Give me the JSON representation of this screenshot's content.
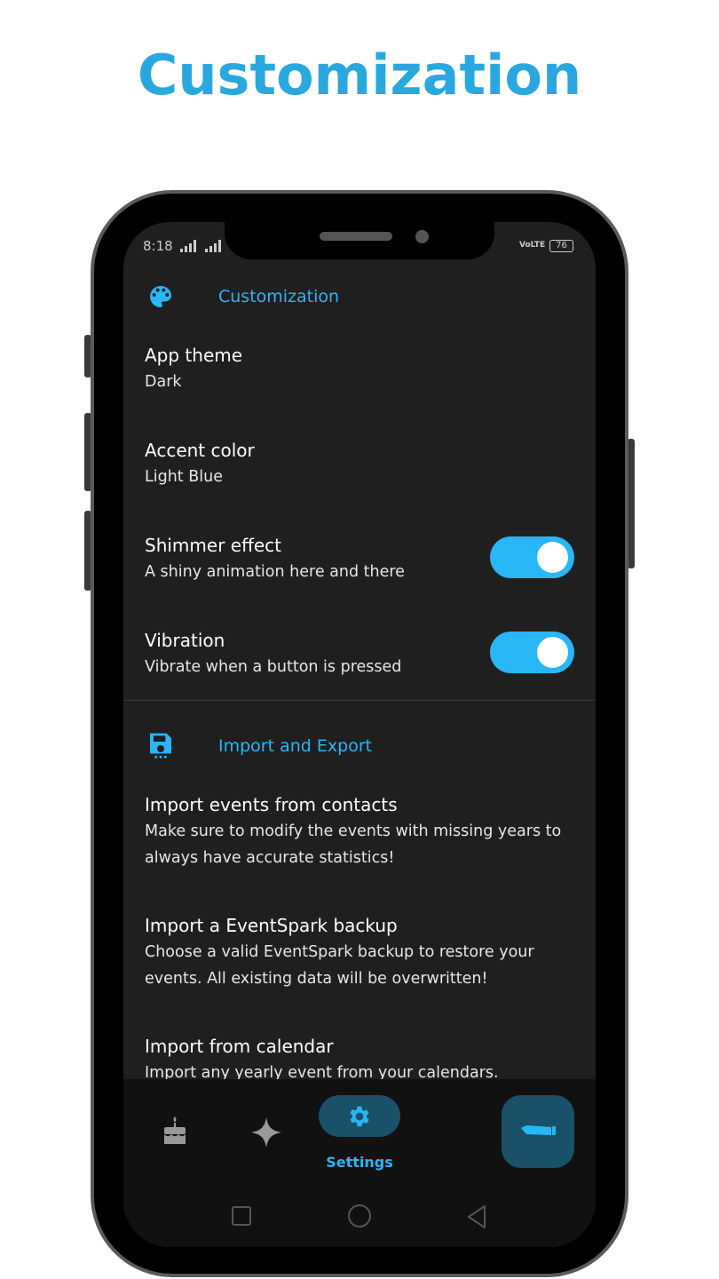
{
  "headline": "Customization",
  "status_bar": {
    "time": "8:18",
    "network": "VoLTE",
    "battery": "76"
  },
  "sections": [
    {
      "title": "Customization",
      "icon": "palette-icon",
      "items": [
        {
          "title": "App theme",
          "subtitle": "Dark"
        },
        {
          "title": "Accent color",
          "subtitle": "Light Blue"
        },
        {
          "title": "Shimmer effect",
          "subtitle": "A shiny animation here and there",
          "toggle": true
        },
        {
          "title": "Vibration",
          "subtitle": "Vibrate when a button is pressed",
          "toggle": true
        }
      ]
    },
    {
      "title": "Import and Export",
      "icon": "save-icon",
      "items": [
        {
          "title": "Import events from contacts",
          "subtitle": "Make sure to modify the events with missing years to always have accurate statistics!"
        },
        {
          "title": "Import a EventSpark backup",
          "subtitle": "Choose a valid EventSpark backup to restore your events. All existing data will be overwritten!"
        },
        {
          "title": "Import from calendar",
          "subtitle": "Import any yearly event from your calendars."
        }
      ]
    }
  ],
  "bottom_nav": {
    "items": [
      {
        "icon": "cake-icon"
      },
      {
        "icon": "sparkle-icon"
      },
      {
        "icon": "gear-icon",
        "label": "Settings",
        "selected": true
      }
    ],
    "fab_icon": "pen-icon"
  },
  "colors": {
    "accent": "#29b6f6",
    "headline": "#29a8e0",
    "background": "#1f1f1f"
  }
}
